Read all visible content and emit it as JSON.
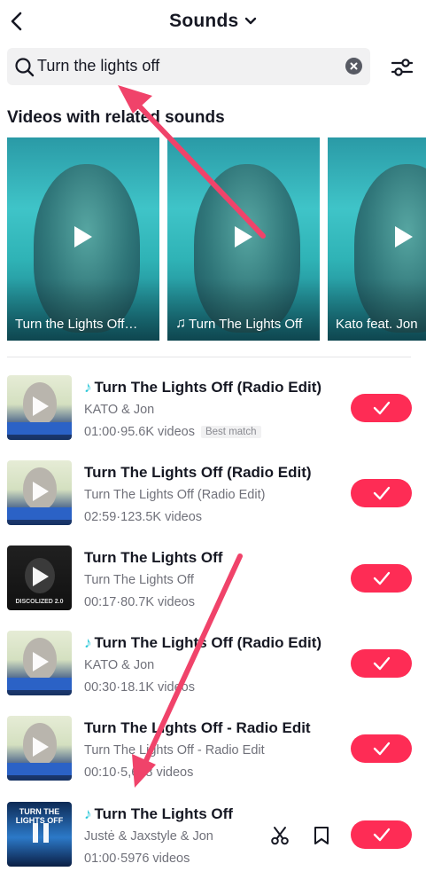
{
  "header": {
    "title": "Sounds",
    "back_icon": "chevron-left-icon",
    "title_icon": "chevron-down-icon"
  },
  "search": {
    "value": "Turn the lights off",
    "icon": "search-icon",
    "clear_icon": "clear-icon",
    "filter_icon": "filter-sliders-icon"
  },
  "related": {
    "title": "Videos with related sounds",
    "videos": [
      {
        "caption": "Turn the Lights Off…",
        "has_note": false
      },
      {
        "caption": "Turn The Lights Off",
        "has_note": true
      },
      {
        "caption": "Kato feat. Jon",
        "has_note": false
      }
    ]
  },
  "sounds": [
    {
      "title": "Turn The Lights Off (Radio Edit)",
      "note": true,
      "artist": "KATO & Jon",
      "duration": "01:00",
      "videos": "95.6K videos",
      "badge": "Best match",
      "thumb": "light",
      "state": "play"
    },
    {
      "title": "Turn The Lights Off (Radio Edit)",
      "note": false,
      "artist": "Turn The Lights Off (Radio Edit)",
      "duration": "02:59",
      "videos": "123.5K videos",
      "thumb": "light",
      "state": "play"
    },
    {
      "title": "Turn The Lights Off",
      "note": false,
      "artist": "Turn The Lights Off",
      "duration": "00:17",
      "videos": "80.7K videos",
      "thumb": "dark",
      "thumb_label": "DISCOLIZED 2.0",
      "state": "play"
    },
    {
      "title": "Turn The Lights Off (Radio Edit)",
      "note": true,
      "artist": "KATO & Jon",
      "duration": "00:30",
      "videos": "18.1K videos",
      "thumb": "light",
      "state": "play"
    },
    {
      "title": "Turn The Lights Off - Radio Edit",
      "note": false,
      "artist": "Turn The Lights Off - Radio Edit",
      "duration": "00:10",
      "videos": "5,688 videos",
      "thumb": "light",
      "state": "play"
    },
    {
      "title": "Turn The Lights Off",
      "note": true,
      "artist": "Justė & Jaxstyle & Jon",
      "duration": "01:00",
      "videos": "5976 videos",
      "thumb": "blue",
      "thumb_label": "TURN THE LIGHTS OFF",
      "state": "pause",
      "actions": [
        "scissors-icon",
        "bookmark-icon"
      ]
    }
  ],
  "meta_separator": " · ",
  "use_icon": "checkmark-icon",
  "colors": {
    "accent": "#fe2c55",
    "note": "#25c6d8",
    "annotation_arrow": "#f0436a",
    "secondary_text": "#70717a"
  }
}
